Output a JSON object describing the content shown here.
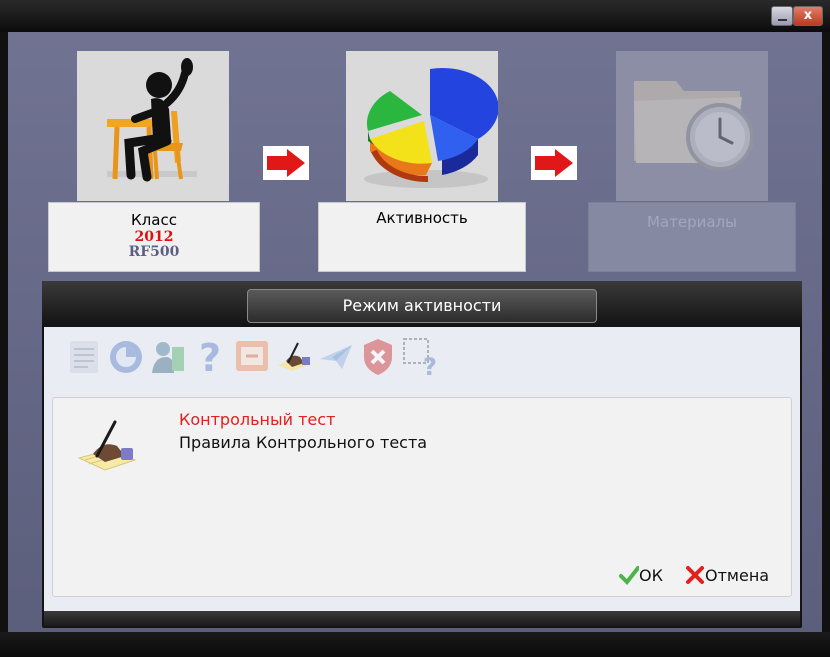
{
  "window": {
    "close_glyph": "x",
    "minimize_icon": "minimize-icon",
    "close_icon": "close-icon"
  },
  "steps": [
    {
      "label": "Класс",
      "year": "2012",
      "model": "RF500",
      "icon": "student-figure-icon",
      "enabled": true
    },
    {
      "label": "Активность",
      "icon": "pie-chart-icon",
      "enabled": true
    },
    {
      "label": "Материалы",
      "icon": "folder-clock-icon",
      "enabled": false
    }
  ],
  "dialog": {
    "title": "Режим активности",
    "toolbar_icons": [
      "calendar-icon",
      "chart-refresh-icon",
      "person-book-icon",
      "question-icon",
      "presentation-icon",
      "signing-hand-icon",
      "paper-plane-icon",
      "shield-x-icon",
      "selection-question-icon"
    ],
    "test_name": "Контрольный тест",
    "test_rules": "Правила Контрольного теста",
    "ok_label": "ОК",
    "cancel_label": "Отмена"
  },
  "colors": {
    "accent_red": "#e3201c",
    "arrow_red": "#e01818",
    "ok_green": "#4db34a",
    "background": "#636684"
  }
}
